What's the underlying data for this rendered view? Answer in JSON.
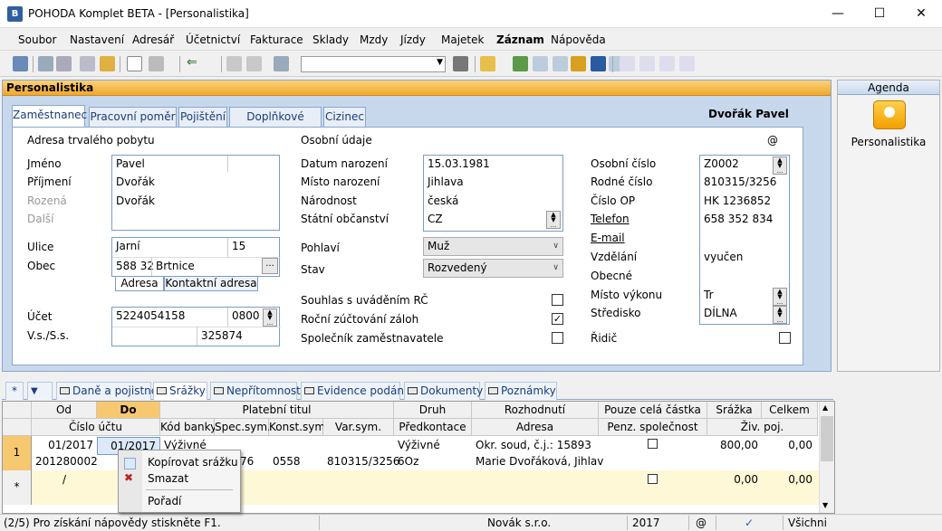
{
  "window": {
    "title": "POHODA Komplet BETA - [Personalistika]",
    "app_icon": "B"
  },
  "menu": [
    "Soubor",
    "Nastavení",
    "Adresář",
    "Účetnictví",
    "Fakturace",
    "Sklady",
    "Mzdy",
    "Jízdy",
    "Majetek",
    "Záznam",
    "Nápověda"
  ],
  "panel": {
    "title": "Personalistika",
    "employee_name": "Dvořák Pavel",
    "at_symbol": "@"
  },
  "tabs": [
    "Zaměstnanec",
    "Pracovní poměr",
    "Pojištění",
    "Doplňkové údaje",
    "Cizinec"
  ],
  "address": {
    "section_title": "Adresa trvalého pobytu",
    "labels": {
      "jmeno": "Jméno",
      "prijmeni": "Příjmení",
      "rozena": "Rozená",
      "dalsi": "Další",
      "ulice": "Ulice",
      "obec": "Obec",
      "ucet": "Účet",
      "vss": "V.s./S.s."
    },
    "jmeno": "Pavel",
    "prijmeni": "Dvořák",
    "rozena": "Dvořák",
    "ulice": "Jarní",
    "cislo": "15",
    "psc": "588 32",
    "obec": "Brtnice",
    "subtabs": [
      "Adresa",
      "Kontaktní adresa"
    ],
    "ucet": "5224054158",
    "kod_banky": "0800",
    "ss": "325874"
  },
  "personal": {
    "section_title": "Osobní údaje",
    "labels": {
      "datum": "Datum narození",
      "misto": "Místo narození",
      "narodnost": "Národnost",
      "obcanstvi": "Státní občanství",
      "pohlavi": "Pohlaví",
      "stav": "Stav",
      "souhlas": "Souhlas s uváděním RČ",
      "rocni": "Roční zúčtování záloh",
      "spolecnik": "Společník zaměstnavatele"
    },
    "datum": "15.03.1981",
    "misto": "Jihlava",
    "narodnost": "česká",
    "obcanstvi": "CZ",
    "pohlavi": "Muž",
    "stav": "Rozvedený"
  },
  "right": {
    "labels": {
      "osobni_cislo": "Osobní číslo",
      "rodne_cislo": "Rodné číslo",
      "cislo_op": "Číslo OP",
      "telefon": "Telefon",
      "email": "E-mail",
      "vzdelani": "Vzdělání",
      "obecne": "Obecné",
      "misto_vykonu": "Místo výkonu",
      "stredisko": "Středisko",
      "ridic": "Řidič"
    },
    "osobni_cislo": "Z0002",
    "rodne_cislo": "810315/3256",
    "cislo_op": "HK 1236852",
    "telefon": "658 352 834",
    "vzdelani": "vyučen",
    "misto_vykonu": "Tr",
    "stredisko": "DÍLNA"
  },
  "agenda": {
    "header": "Agenda",
    "label": "Personalistika"
  },
  "bottom_tabs": [
    "*",
    "Daně a pojistné",
    "Srážky",
    "Nepřítomnost",
    "Evidence podání",
    "Dokumenty",
    "Poznámky"
  ],
  "grid": {
    "headers_row1": [
      "Od",
      "Do",
      "Platební titul",
      "Druh",
      "Rozhodnutí",
      "Pouze celá částka",
      "Srážka",
      "Celkem"
    ],
    "headers_row2": [
      "Číslo účtu",
      "Kód banky",
      "Spec.sym.",
      "Konst.sym.",
      "Var.sym.",
      "Předkontace",
      "Adresa",
      "Penz. společnost",
      "Živ. poj."
    ],
    "row1": {
      "num": "1",
      "od": "01/2017",
      "do": "01/2017",
      "titul": "Výživné",
      "druh": "Výživné",
      "rozhodnuti": "Okr. soud, č.j.: 15893",
      "srazka": "800,00",
      "celkem": "0,00"
    },
    "row2": {
      "ucet": "201280002",
      "spec": "76",
      "konst": "0558",
      "var": "810315/3256",
      "predkontace": "6Oz",
      "adresa": "Marie Dvořáková, Jihlav"
    },
    "row3": {
      "num": "*",
      "od": "/",
      "srazka": "0,00",
      "celkem": "0,00"
    }
  },
  "context_menu": [
    "Kopírovat srážku",
    "Smazat",
    "Pořadí"
  ],
  "status": {
    "help": "(2/5) Pro získání nápovědy stiskněte F1.",
    "company": "Novák s.r.o.",
    "year": "2017",
    "at": "@",
    "check": "✓",
    "filter": "Všichni"
  }
}
